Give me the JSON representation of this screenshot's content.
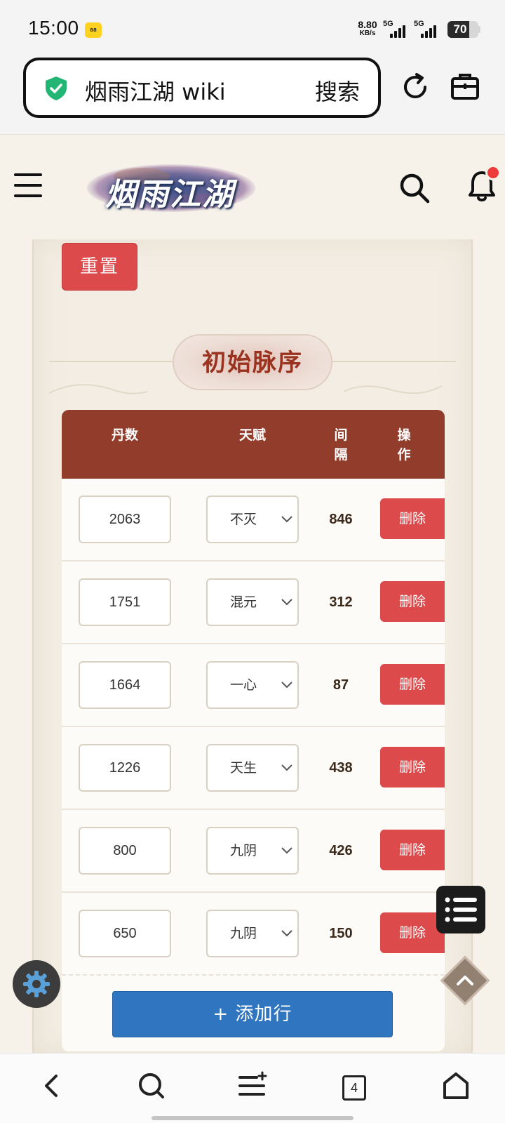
{
  "status_bar": {
    "time": "15:00",
    "chip_label": "88",
    "net_speed_value": "8.80",
    "net_speed_unit": "KB/s",
    "signal_1_label": "5G",
    "signal_2_label": "5G",
    "battery_level": "70"
  },
  "browser": {
    "url_title": "烟雨江湖 wiki",
    "search_label": "搜索",
    "tab_count": "4"
  },
  "header": {
    "logo_text": "烟雨江湖"
  },
  "page": {
    "reset_label": "重置",
    "section_title": "初始脉序",
    "add_row_label": "+ 添加行"
  },
  "table": {
    "headers": [
      "丹数",
      "天赋",
      "间\n隔",
      "操\n作"
    ],
    "rows": [
      {
        "qty": "2063",
        "talent": "不灭",
        "interval": "846",
        "action": "删除"
      },
      {
        "qty": "1751",
        "talent": "混元",
        "interval": "312",
        "action": "删除"
      },
      {
        "qty": "1664",
        "talent": "一心",
        "interval": "87",
        "action": "删除"
      },
      {
        "qty": "1226",
        "talent": "天生",
        "interval": "438",
        "action": "删除"
      },
      {
        "qty": "800",
        "talent": "九阴",
        "interval": "426",
        "action": "删除"
      },
      {
        "qty": "650",
        "talent": "九阴",
        "interval": "150",
        "action": "删除"
      }
    ]
  },
  "colors": {
    "accent_red": "#dc4a4b",
    "header_brown": "#923d2c",
    "add_blue": "#2f75c0"
  }
}
